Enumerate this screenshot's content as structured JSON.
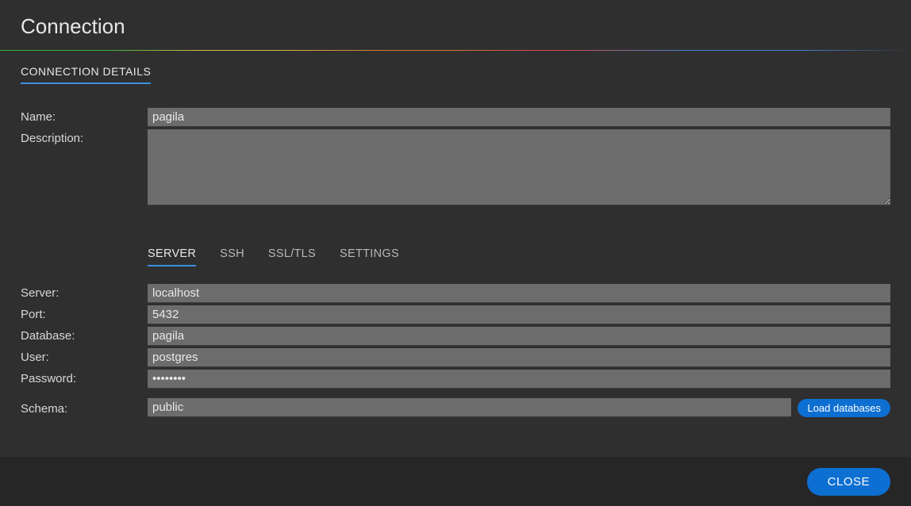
{
  "header": {
    "title": "Connection"
  },
  "section": {
    "label": "CONNECTION DETAILS"
  },
  "fields": {
    "name_label": "Name:",
    "name_value": "pagila",
    "description_label": "Description:",
    "description_value": ""
  },
  "subtabs": {
    "server": "SERVER",
    "ssh": "SSH",
    "ssl": "SSL/TLS",
    "settings": "SETTINGS"
  },
  "server_fields": {
    "server_label": "Server:",
    "server_value": "localhost",
    "port_label": "Port:",
    "port_value": "5432",
    "database_label": "Database:",
    "database_value": "pagila",
    "user_label": "User:",
    "user_value": "postgres",
    "password_label": "Password:",
    "password_value": "••••••••",
    "schema_label": "Schema:",
    "schema_value": "public",
    "load_button": "Load databases"
  },
  "footer": {
    "close": "CLOSE"
  }
}
